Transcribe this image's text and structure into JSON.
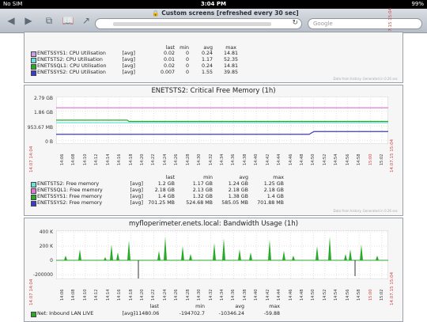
{
  "status_bar": {
    "carrier": "No SIM",
    "time": "3:04 PM",
    "battery": "99%"
  },
  "browser": {
    "page_title": "Custom screens [refreshed every 30 sec]",
    "search_placeholder": "Google",
    "icons": [
      "back-icon",
      "forward-icon",
      "tabs-icon",
      "bookmarks-icon",
      "share-icon",
      "lock-icon",
      "refresh-icon"
    ]
  },
  "panel_top": {
    "headers": [
      "last",
      "min",
      "avg",
      "max"
    ],
    "rows": [
      {
        "name": "ENETSSYS1: CPU Utilisation",
        "agg": "[avg]",
        "last": "0.02",
        "min": "0",
        "avg": "0.24",
        "max": "14.81",
        "color": "#c8a2e8"
      },
      {
        "name": "ENETSTS2: CPU Utilisation",
        "agg": "[avg]",
        "last": "0.01",
        "min": "0",
        "avg": "1.17",
        "max": "52.35",
        "color": "#67e3d9"
      },
      {
        "name": "ENETSSQL1: CPU Utilisation",
        "agg": "[avg]",
        "last": "0.02",
        "min": "0",
        "avg": "0.24",
        "max": "14.81",
        "color": "#2aa82a"
      },
      {
        "name": "ENETSSYS2: CPU Utilisation",
        "agg": "[avg]",
        "last": "0.007",
        "min": "0",
        "avg": "1.55",
        "max": "39.85",
        "color": "#3a3ad0"
      }
    ],
    "credit": "Data from history. Generated in 0.26 sec"
  },
  "panel_memory": {
    "title": "ENETSTS2: Critical Free Memory  (1h)",
    "y_ticks": [
      "2.79 GB",
      "1.86 GB",
      "953.67 MB",
      "0 B"
    ],
    "x_ticks": [
      "14:06",
      "14:08",
      "14:10",
      "14:12",
      "14:14",
      "14:16",
      "14:18",
      "14:20",
      "14:22",
      "14:24",
      "14:26",
      "14:28",
      "14:30",
      "14:32",
      "14:34",
      "14:36",
      "14:38",
      "14:40",
      "14:42",
      "14:44",
      "14:46",
      "14:48",
      "14:50",
      "14:52",
      "14:54",
      "14:56",
      "14:58",
      "15:00",
      "15:02"
    ],
    "date_left": "14.07 14:04",
    "date_right": "14.07.15 15:04",
    "headers": [
      "last",
      "min",
      "avg",
      "max"
    ],
    "rows": [
      {
        "name": "ENETSTS2: Free memory",
        "agg": "[avg]",
        "last": "1.2 GB",
        "min": "1.17 GB",
        "avg": "1.24 GB",
        "max": "1.25 GB",
        "color": "#67e3d9"
      },
      {
        "name": "ENETSSQL1: Free memory",
        "agg": "[avg]",
        "last": "2.18 GB",
        "min": "2.13 GB",
        "avg": "2.18 GB",
        "max": "2.18 GB",
        "color": "#e07ad8"
      },
      {
        "name": "ENETSSYS1: Free memory",
        "agg": "[avg]",
        "last": "1.4 GB",
        "min": "1.32 GB",
        "avg": "1.38 GB",
        "max": "1.4 GB",
        "color": "#2aa82a"
      },
      {
        "name": "ENETSSYS2: Free memory",
        "agg": "[avg]",
        "last": "701.25 MB",
        "min": "524.68 MB",
        "avg": "585.05 MB",
        "max": "701.88 MB",
        "color": "#3a3ad0"
      }
    ],
    "credit": "Data from history. Generated in 0.26 sec"
  },
  "panel_bandwidth": {
    "title": "myfloperimeter.enets.local: Bandwidth Usage  (1h)",
    "y_ticks": [
      "400 K",
      "200 K",
      "0",
      "-200000"
    ],
    "x_ticks": [
      "14:06",
      "14:08",
      "14:10",
      "14:12",
      "14:14",
      "14:16",
      "14:18",
      "14:20",
      "14:22",
      "14:24",
      "14:26",
      "14:28",
      "14:30",
      "14:32",
      "14:34",
      "14:36",
      "14:38",
      "14:40",
      "14:42",
      "14:44",
      "14:46",
      "14:48",
      "14:50",
      "14:52",
      "14:54",
      "14:56",
      "14:58",
      "15:00",
      "15:02"
    ],
    "date_left": "14.07 14:04",
    "date_right": "14.07.15 15:04",
    "headers": [
      "last",
      "min",
      "avg",
      "max"
    ],
    "rows": [
      {
        "name": "Net: Inbound LAN LIVE",
        "agg": "[avg]",
        "last": "-11480.06",
        "min": "-194702.7",
        "avg": "-10346.24",
        "max": "-59.88",
        "color": "#2aa82a"
      }
    ]
  }
}
